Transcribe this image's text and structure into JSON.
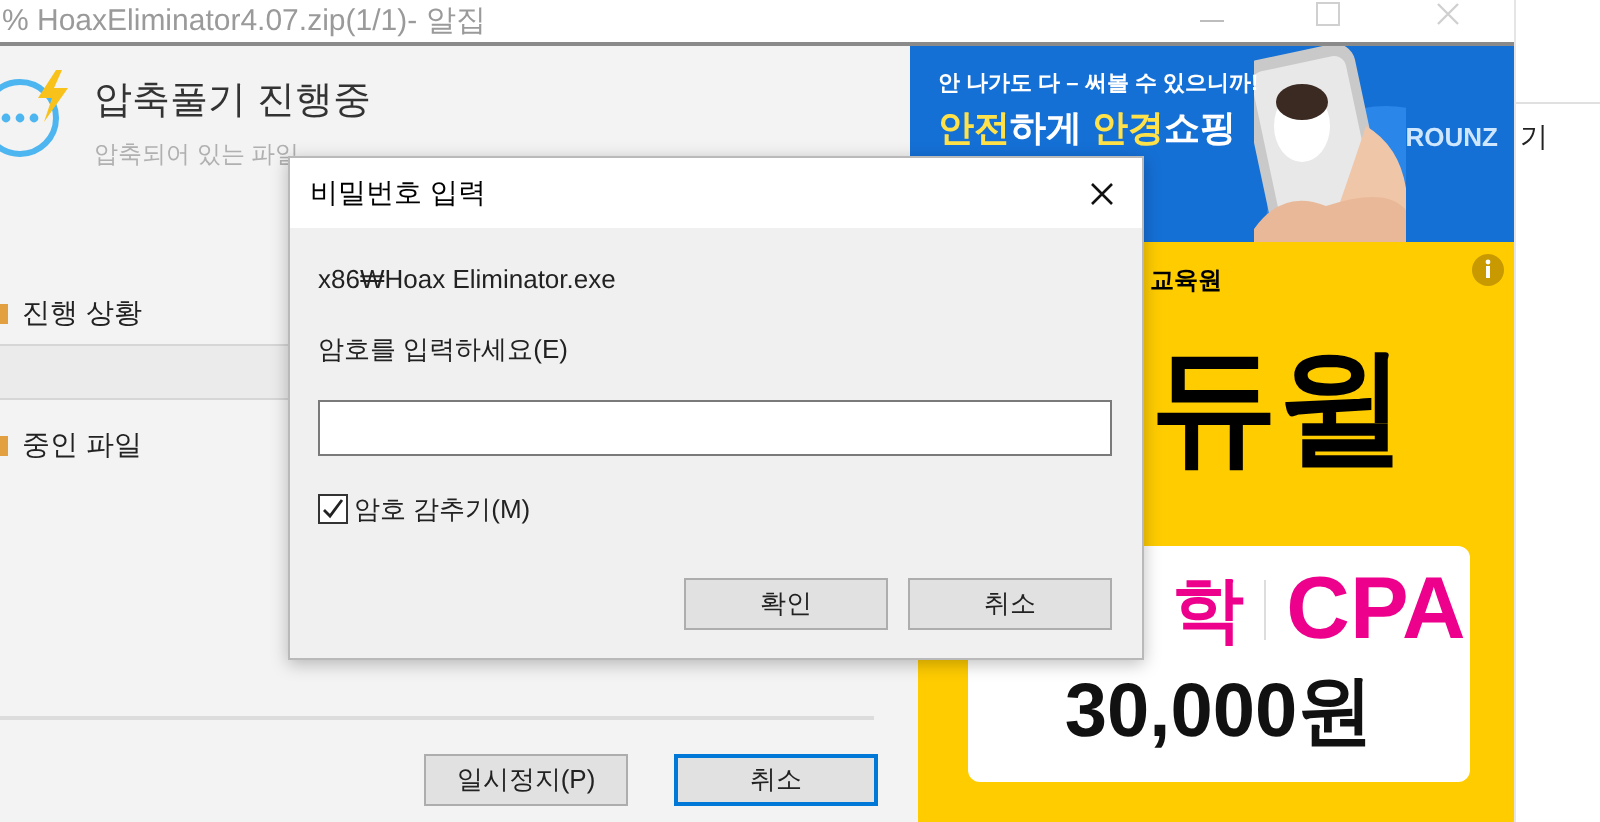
{
  "window": {
    "title": "% HoaxEliminator4.07.zip(1/1)- 알집"
  },
  "progress_panel": {
    "heading": "압축풀기 진행중",
    "subtitle": "압축되어 있는 파일",
    "sections": [
      {
        "label": "진행 상황"
      },
      {
        "label": "중인 파일"
      }
    ],
    "buttons": [
      {
        "label": "일시정지(P)",
        "focused": false
      },
      {
        "label": "취소",
        "focused": true
      }
    ]
  },
  "ad_top": {
    "tagline": "안 나가도 다 – 써볼 수 있으니까!",
    "headline": [
      {
        "text": "안전",
        "highlight": true
      },
      {
        "text": "하게 ",
        "highlight": false
      },
      {
        "text": "안경",
        "highlight": true
      },
      {
        "text": "쇼핑",
        "highlight": false
      }
    ],
    "brand": "ROUNZ"
  },
  "ad_side": {
    "header": "교육원",
    "title": "듀윌",
    "subject_1": "학",
    "subject_2": "CPA",
    "price": "30,000원"
  },
  "right_pane": {
    "text": "기"
  },
  "password_dialog": {
    "title": "비밀번호 입력",
    "file_path": "x86₩Hoax Eliminator.exe",
    "prompt": "암호를 입력하세요(E)",
    "hide_password": {
      "label": "암호 감추기(M)",
      "checked": true
    },
    "buttons": [
      {
        "label": "확인"
      },
      {
        "label": "취소"
      }
    ]
  }
}
